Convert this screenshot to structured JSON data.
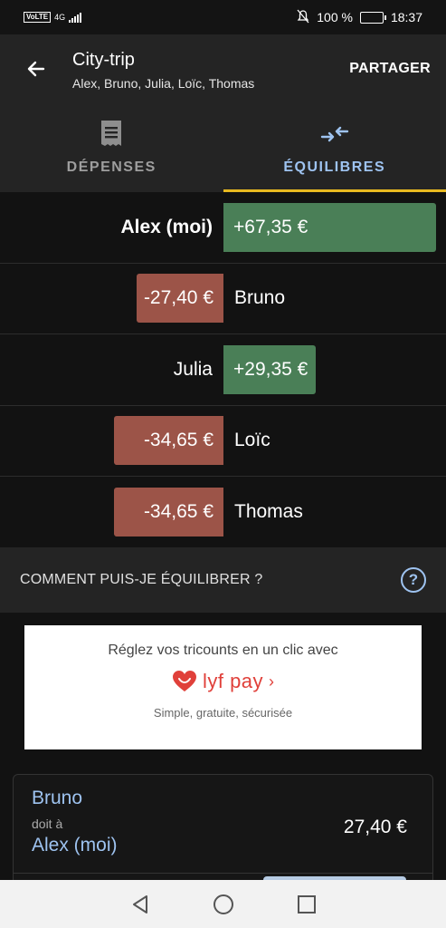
{
  "status_bar": {
    "volte": "VoLTE",
    "network": "4G",
    "battery_percent": "100 %",
    "time": "18:37"
  },
  "app_bar": {
    "title": "City-trip",
    "subtitle": "Alex, Bruno, Julia, Loïc, Thomas",
    "share_label": "PARTAGER"
  },
  "tabs": [
    {
      "label": "DÉPENSES",
      "icon": "receipt-icon",
      "selected": false
    },
    {
      "label": "ÉQUILIBRES",
      "icon": "balance-arrows-icon",
      "selected": true
    }
  ],
  "balances": [
    {
      "name": "Alex (moi)",
      "amount": "+67,35 €",
      "value": 67.35,
      "is_me": true
    },
    {
      "name": "Bruno",
      "amount": "-27,40 €",
      "value": -27.4,
      "is_me": false
    },
    {
      "name": "Julia",
      "amount": "+29,35 €",
      "value": 29.35,
      "is_me": false
    },
    {
      "name": "Loïc",
      "amount": "-34,65 €",
      "value": -34.65,
      "is_me": false
    },
    {
      "name": "Thomas",
      "amount": "-34,65 €",
      "value": -34.65,
      "is_me": false
    }
  ],
  "how_to": {
    "label": "COMMENT PUIS-JE ÉQUILIBRER ?"
  },
  "ad": {
    "line1": "Réglez vos tricounts en un clic avec",
    "brand": "lyf pay",
    "chevron": "›",
    "tagline": "Simple, gratuite, sécurisée"
  },
  "settlement": {
    "from": "Bruno",
    "owes": "doit à",
    "to": "Alex (moi)",
    "amount": "27,40 €"
  },
  "colors": {
    "positive": "#4a7f57",
    "negative": "#9c5448",
    "accent": "#9ec3f0",
    "tab_indicator": "#e8b920"
  }
}
